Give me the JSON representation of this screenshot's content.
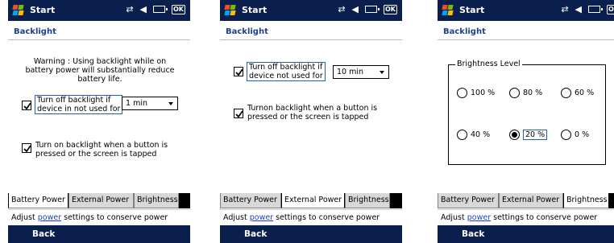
{
  "title_bar": {
    "app_name": "Start"
  },
  "colors": {
    "title_bar_bg": "#0a1f4e",
    "app_title_color": "#1f3f8f",
    "link_color": "#1f3fbf"
  },
  "icons": [
    "windows-flag-icon",
    "connectivity-icon",
    "speaker-icon",
    "battery-icon",
    "ok-icon",
    "checkmark-icon"
  ],
  "screens": [
    {
      "page_title": "Backlight",
      "warning": "Warning : Using backlight while on battery power will substantially reduce battery life.",
      "turn_off_line1": "Turn off backlight if",
      "turn_off_line2": "device in not used for",
      "turn_off_checked": true,
      "timeout_value": "1 min",
      "turn_on_line1": "Turn on backlight when a button is",
      "turn_on_line2": "pressed or the screen is tapped",
      "turn_on_checked": true,
      "tabs": [
        "Battery Power",
        "External Power",
        "Brightness"
      ],
      "active_tab": "Battery Power"
    },
    {
      "page_title": "Backlight",
      "turn_off_line1": "Turn off backlight if",
      "turn_off_line2": "device not used for",
      "turn_off_checked": true,
      "timeout_value": "10 min",
      "turn_on_line1": "Turnon backlight when a button is",
      "turn_on_line2": "pressed or the screen is tapped",
      "turn_on_checked": true,
      "tabs": [
        "Battery Power",
        "External Power",
        "Brightness"
      ],
      "active_tab": "External Power"
    },
    {
      "page_title": "Backlight",
      "group_label": "Brightness Level",
      "options": [
        "100 %",
        "80 %",
        "60 %",
        "40 %",
        "20 %",
        "0 %"
      ],
      "selected_option": "20 %",
      "tabs": [
        "Battery Power",
        "External Power",
        "Brightness"
      ],
      "active_tab": "Brightness"
    }
  ],
  "footer": {
    "prefix": "Adjust",
    "link": "power",
    "suffix": "settings to conserve power"
  },
  "softkey": {
    "back": "Back"
  }
}
